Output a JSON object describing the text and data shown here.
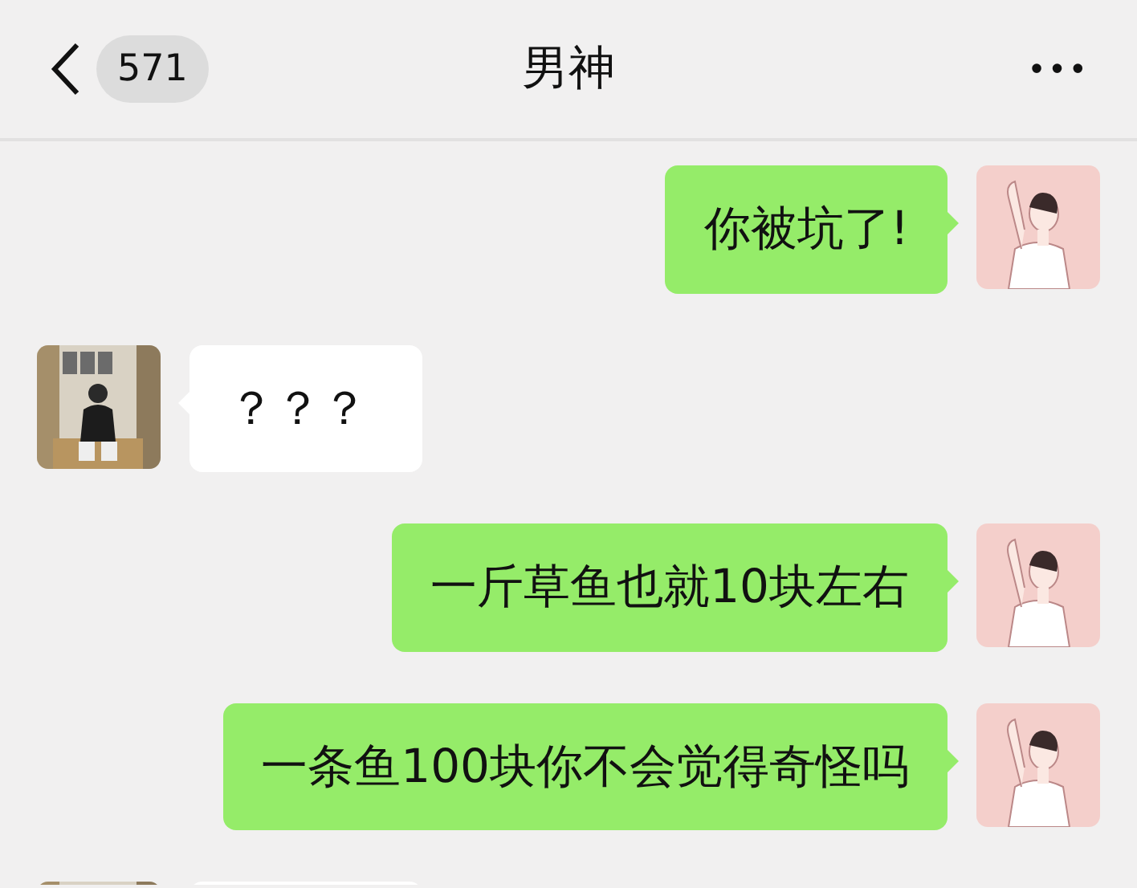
{
  "header": {
    "unread": "571",
    "title": "男神",
    "more": "•••"
  },
  "messages": [
    {
      "kind": "outgoing",
      "text": "你被坑了!"
    },
    {
      "kind": "incoming",
      "text": "？？？"
    },
    {
      "kind": "outgoing",
      "text": "一斤草鱼也就10块左右"
    },
    {
      "kind": "outgoing",
      "text": "一条鱼100块你不会觉得奇怪吗"
    },
    {
      "kind": "incoming"
    }
  ]
}
